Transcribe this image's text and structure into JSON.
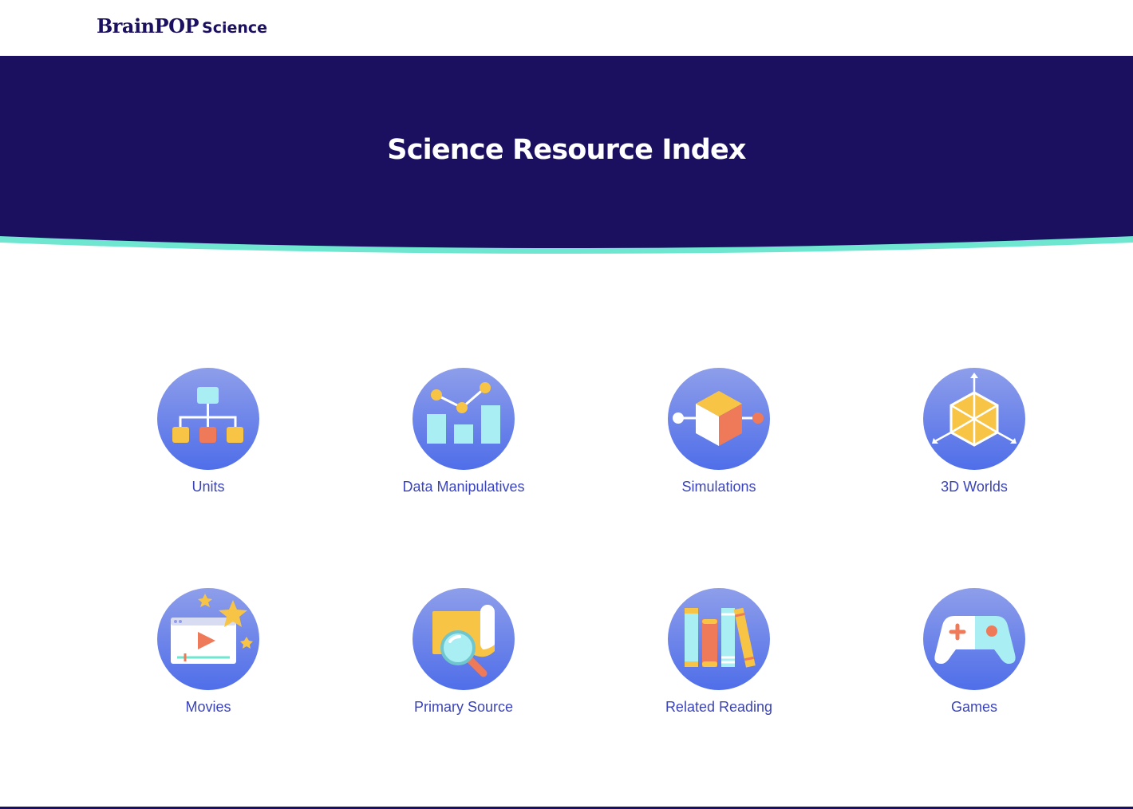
{
  "header": {
    "logo_brand": "BrainPOP",
    "logo_sub": "Science"
  },
  "hero": {
    "title": "Science Resource Index"
  },
  "colors": {
    "navy": "#1b1060",
    "teal_accent": "#6fe6cf",
    "link_blue": "#3b44b8",
    "circle_top": "#8e9eea",
    "circle_bottom": "#4f6ee9",
    "icon_yellow": "#f7c445",
    "icon_coral": "#ee7a5a",
    "icon_aqua": "#a8eef2"
  },
  "resources": [
    {
      "label": "Units",
      "icon": "hierarchy-icon"
    },
    {
      "label": "Data Manipulatives",
      "icon": "chart-icon"
    },
    {
      "label": "Simulations",
      "icon": "cube-icon"
    },
    {
      "label": "3D Worlds",
      "icon": "hexagon-3d-icon"
    },
    {
      "label": "Movies",
      "icon": "video-player-icon"
    },
    {
      "label": "Primary Source",
      "icon": "magnifier-scroll-icon"
    },
    {
      "label": "Related Reading",
      "icon": "books-icon"
    },
    {
      "label": "Games",
      "icon": "gamepad-icon"
    }
  ]
}
